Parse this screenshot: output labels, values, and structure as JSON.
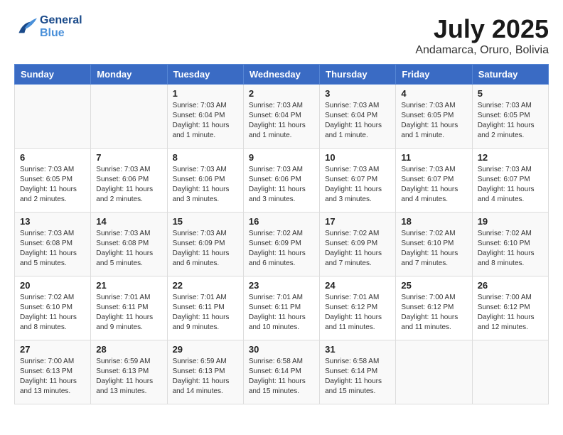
{
  "logo": {
    "line1": "General",
    "line2": "Blue"
  },
  "title": "July 2025",
  "location": "Andamarca, Oruro, Bolivia",
  "days_of_week": [
    "Sunday",
    "Monday",
    "Tuesday",
    "Wednesday",
    "Thursday",
    "Friday",
    "Saturday"
  ],
  "weeks": [
    [
      {
        "day": "",
        "content": ""
      },
      {
        "day": "",
        "content": ""
      },
      {
        "day": "1",
        "content": "Sunrise: 7:03 AM\nSunset: 6:04 PM\nDaylight: 11 hours and 1 minute."
      },
      {
        "day": "2",
        "content": "Sunrise: 7:03 AM\nSunset: 6:04 PM\nDaylight: 11 hours and 1 minute."
      },
      {
        "day": "3",
        "content": "Sunrise: 7:03 AM\nSunset: 6:04 PM\nDaylight: 11 hours and 1 minute."
      },
      {
        "day": "4",
        "content": "Sunrise: 7:03 AM\nSunset: 6:05 PM\nDaylight: 11 hours and 1 minute."
      },
      {
        "day": "5",
        "content": "Sunrise: 7:03 AM\nSunset: 6:05 PM\nDaylight: 11 hours and 2 minutes."
      }
    ],
    [
      {
        "day": "6",
        "content": "Sunrise: 7:03 AM\nSunset: 6:05 PM\nDaylight: 11 hours and 2 minutes."
      },
      {
        "day": "7",
        "content": "Sunrise: 7:03 AM\nSunset: 6:06 PM\nDaylight: 11 hours and 2 minutes."
      },
      {
        "day": "8",
        "content": "Sunrise: 7:03 AM\nSunset: 6:06 PM\nDaylight: 11 hours and 3 minutes."
      },
      {
        "day": "9",
        "content": "Sunrise: 7:03 AM\nSunset: 6:06 PM\nDaylight: 11 hours and 3 minutes."
      },
      {
        "day": "10",
        "content": "Sunrise: 7:03 AM\nSunset: 6:07 PM\nDaylight: 11 hours and 3 minutes."
      },
      {
        "day": "11",
        "content": "Sunrise: 7:03 AM\nSunset: 6:07 PM\nDaylight: 11 hours and 4 minutes."
      },
      {
        "day": "12",
        "content": "Sunrise: 7:03 AM\nSunset: 6:07 PM\nDaylight: 11 hours and 4 minutes."
      }
    ],
    [
      {
        "day": "13",
        "content": "Sunrise: 7:03 AM\nSunset: 6:08 PM\nDaylight: 11 hours and 5 minutes."
      },
      {
        "day": "14",
        "content": "Sunrise: 7:03 AM\nSunset: 6:08 PM\nDaylight: 11 hours and 5 minutes."
      },
      {
        "day": "15",
        "content": "Sunrise: 7:03 AM\nSunset: 6:09 PM\nDaylight: 11 hours and 6 minutes."
      },
      {
        "day": "16",
        "content": "Sunrise: 7:02 AM\nSunset: 6:09 PM\nDaylight: 11 hours and 6 minutes."
      },
      {
        "day": "17",
        "content": "Sunrise: 7:02 AM\nSunset: 6:09 PM\nDaylight: 11 hours and 7 minutes."
      },
      {
        "day": "18",
        "content": "Sunrise: 7:02 AM\nSunset: 6:10 PM\nDaylight: 11 hours and 7 minutes."
      },
      {
        "day": "19",
        "content": "Sunrise: 7:02 AM\nSunset: 6:10 PM\nDaylight: 11 hours and 8 minutes."
      }
    ],
    [
      {
        "day": "20",
        "content": "Sunrise: 7:02 AM\nSunset: 6:10 PM\nDaylight: 11 hours and 8 minutes."
      },
      {
        "day": "21",
        "content": "Sunrise: 7:01 AM\nSunset: 6:11 PM\nDaylight: 11 hours and 9 minutes."
      },
      {
        "day": "22",
        "content": "Sunrise: 7:01 AM\nSunset: 6:11 PM\nDaylight: 11 hours and 9 minutes."
      },
      {
        "day": "23",
        "content": "Sunrise: 7:01 AM\nSunset: 6:11 PM\nDaylight: 11 hours and 10 minutes."
      },
      {
        "day": "24",
        "content": "Sunrise: 7:01 AM\nSunset: 6:12 PM\nDaylight: 11 hours and 11 minutes."
      },
      {
        "day": "25",
        "content": "Sunrise: 7:00 AM\nSunset: 6:12 PM\nDaylight: 11 hours and 11 minutes."
      },
      {
        "day": "26",
        "content": "Sunrise: 7:00 AM\nSunset: 6:12 PM\nDaylight: 11 hours and 12 minutes."
      }
    ],
    [
      {
        "day": "27",
        "content": "Sunrise: 7:00 AM\nSunset: 6:13 PM\nDaylight: 11 hours and 13 minutes."
      },
      {
        "day": "28",
        "content": "Sunrise: 6:59 AM\nSunset: 6:13 PM\nDaylight: 11 hours and 13 minutes."
      },
      {
        "day": "29",
        "content": "Sunrise: 6:59 AM\nSunset: 6:13 PM\nDaylight: 11 hours and 14 minutes."
      },
      {
        "day": "30",
        "content": "Sunrise: 6:58 AM\nSunset: 6:14 PM\nDaylight: 11 hours and 15 minutes."
      },
      {
        "day": "31",
        "content": "Sunrise: 6:58 AM\nSunset: 6:14 PM\nDaylight: 11 hours and 15 minutes."
      },
      {
        "day": "",
        "content": ""
      },
      {
        "day": "",
        "content": ""
      }
    ]
  ]
}
